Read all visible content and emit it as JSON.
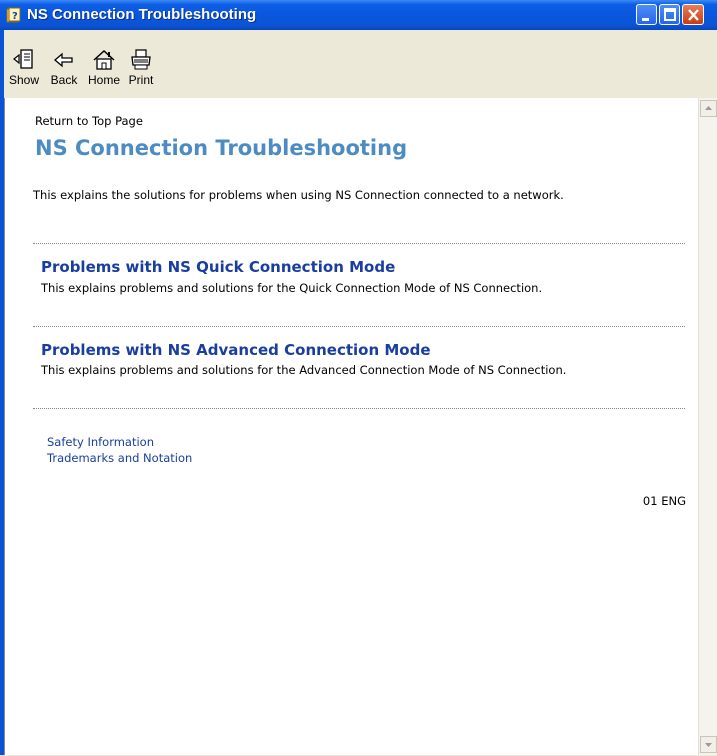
{
  "window": {
    "title": "NS Connection Troubleshooting",
    "icon": "help-book-icon"
  },
  "toolbar": {
    "show_label": "Show",
    "back_label": "Back",
    "home_label": "Home",
    "print_label": "Print"
  },
  "content": {
    "return_link": "Return to Top Page",
    "title": "NS Connection Troubleshooting",
    "intro": "This explains the solutions for problems when using NS Connection connected to a network.",
    "sections": [
      {
        "title": "Problems with NS Quick Connection Mode",
        "description": "This explains problems and solutions for the Quick Connection Mode of NS Connection."
      },
      {
        "title": "Problems with NS Advanced Connection Mode",
        "description": "This explains problems and solutions for the Advanced Connection Mode of NS Connection."
      }
    ],
    "footer_links": [
      "Safety Information",
      "Trademarks and Notation"
    ],
    "version": "01 ENG"
  },
  "colors": {
    "title_bar": "#0a56dc",
    "page_title": "#4d8cc2",
    "link": "#1a3ea0"
  }
}
